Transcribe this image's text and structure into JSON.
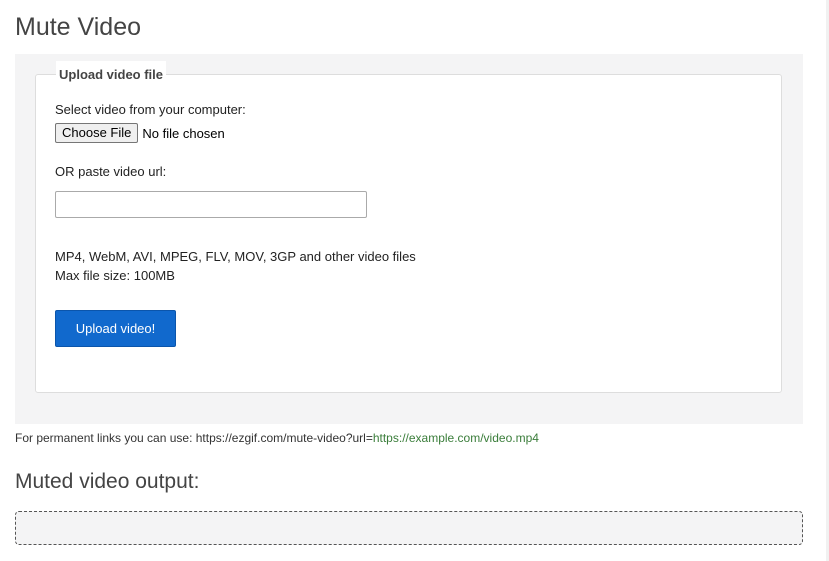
{
  "title": "Mute Video",
  "upload": {
    "legend": "Upload video file",
    "select_label": "Select video from your computer:",
    "choose_file_label": "Choose File",
    "no_file_text": "No file chosen",
    "url_label": "OR paste video url:",
    "url_value": "",
    "url_placeholder": "",
    "formats_line": "MP4, WebM, AVI, MPEG, FLV, MOV, 3GP and other video files",
    "max_size_line": "Max file size: 100MB",
    "submit_label": "Upload video!"
  },
  "permalink": {
    "prefix": "For permanent links you can use: https://ezgif.com/mute-video?url=",
    "example": "https://example.com/video.mp4"
  },
  "output": {
    "title": "Muted video output:"
  },
  "colors": {
    "accent": "#1169cd",
    "panel_bg": "#f4f4f5",
    "link_green": "#3a7d3a"
  }
}
